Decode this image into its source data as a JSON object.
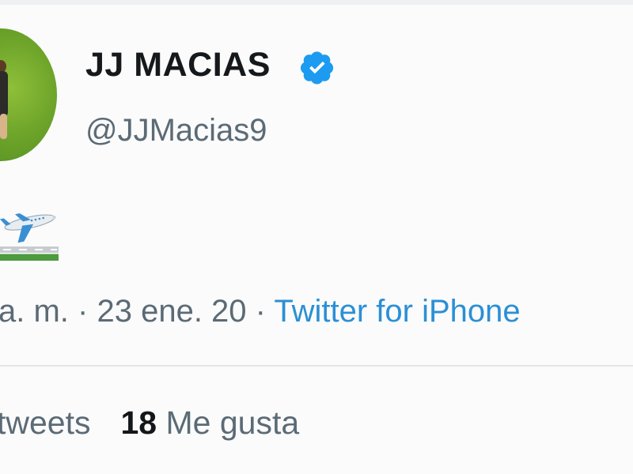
{
  "author": {
    "display_name": "JJ MACIAS",
    "handle": "@JJMacias9",
    "verified": true
  },
  "tweet": {
    "content_emoji": [
      "airplane-departure-emoji",
      "runway-emoji"
    ]
  },
  "meta": {
    "time_partial": "a. m.",
    "separator": "·",
    "date": "23 ene. 20",
    "source": "Twitter for iPhone"
  },
  "stats": {
    "retweets_label_partial": "tweets",
    "likes_count": "18",
    "likes_label": "Me gusta"
  },
  "colors": {
    "verified_badge": "#1d9bf0",
    "link": "#2b8fd6",
    "text_secondary": "#5b6b76"
  }
}
